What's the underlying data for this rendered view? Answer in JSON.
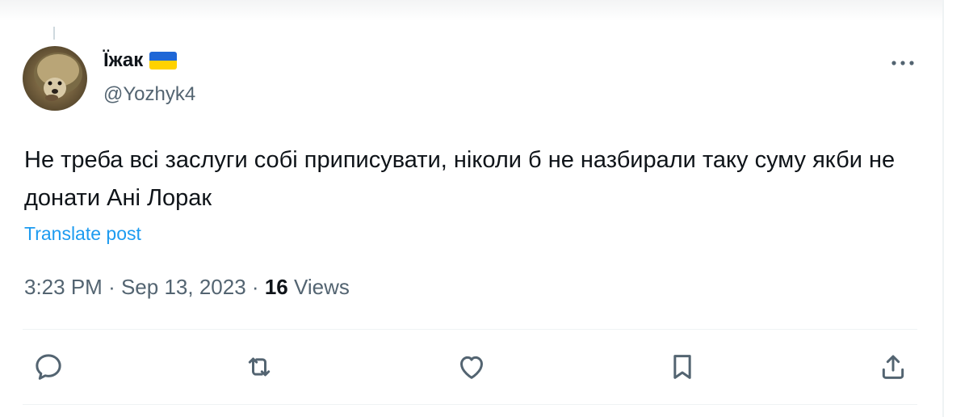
{
  "post": {
    "display_name": "Їжак",
    "flag_icon": "ukraine-flag-icon",
    "handle": "@Yozhyk4",
    "text": "Не треба всі заслуги собі приписувати, ніколи б не назбирали таку суму якби не донати Ані Лорак",
    "translate_label": "Translate post",
    "time": "3:23 PM",
    "date": "Sep 13, 2023",
    "separator": "·",
    "views_count": "16",
    "views_label": "Views"
  },
  "actions": [
    {
      "icon": "reply-icon"
    },
    {
      "icon": "repost-icon"
    },
    {
      "icon": "like-icon"
    },
    {
      "icon": "bookmark-icon"
    },
    {
      "icon": "share-icon"
    }
  ],
  "colors": {
    "text_primary": "#0f1419",
    "text_secondary": "#536471",
    "link": "#1d9bf0",
    "divider": "#eff3f4",
    "flag_blue": "#1f67d6",
    "flag_yellow": "#ffd200"
  }
}
